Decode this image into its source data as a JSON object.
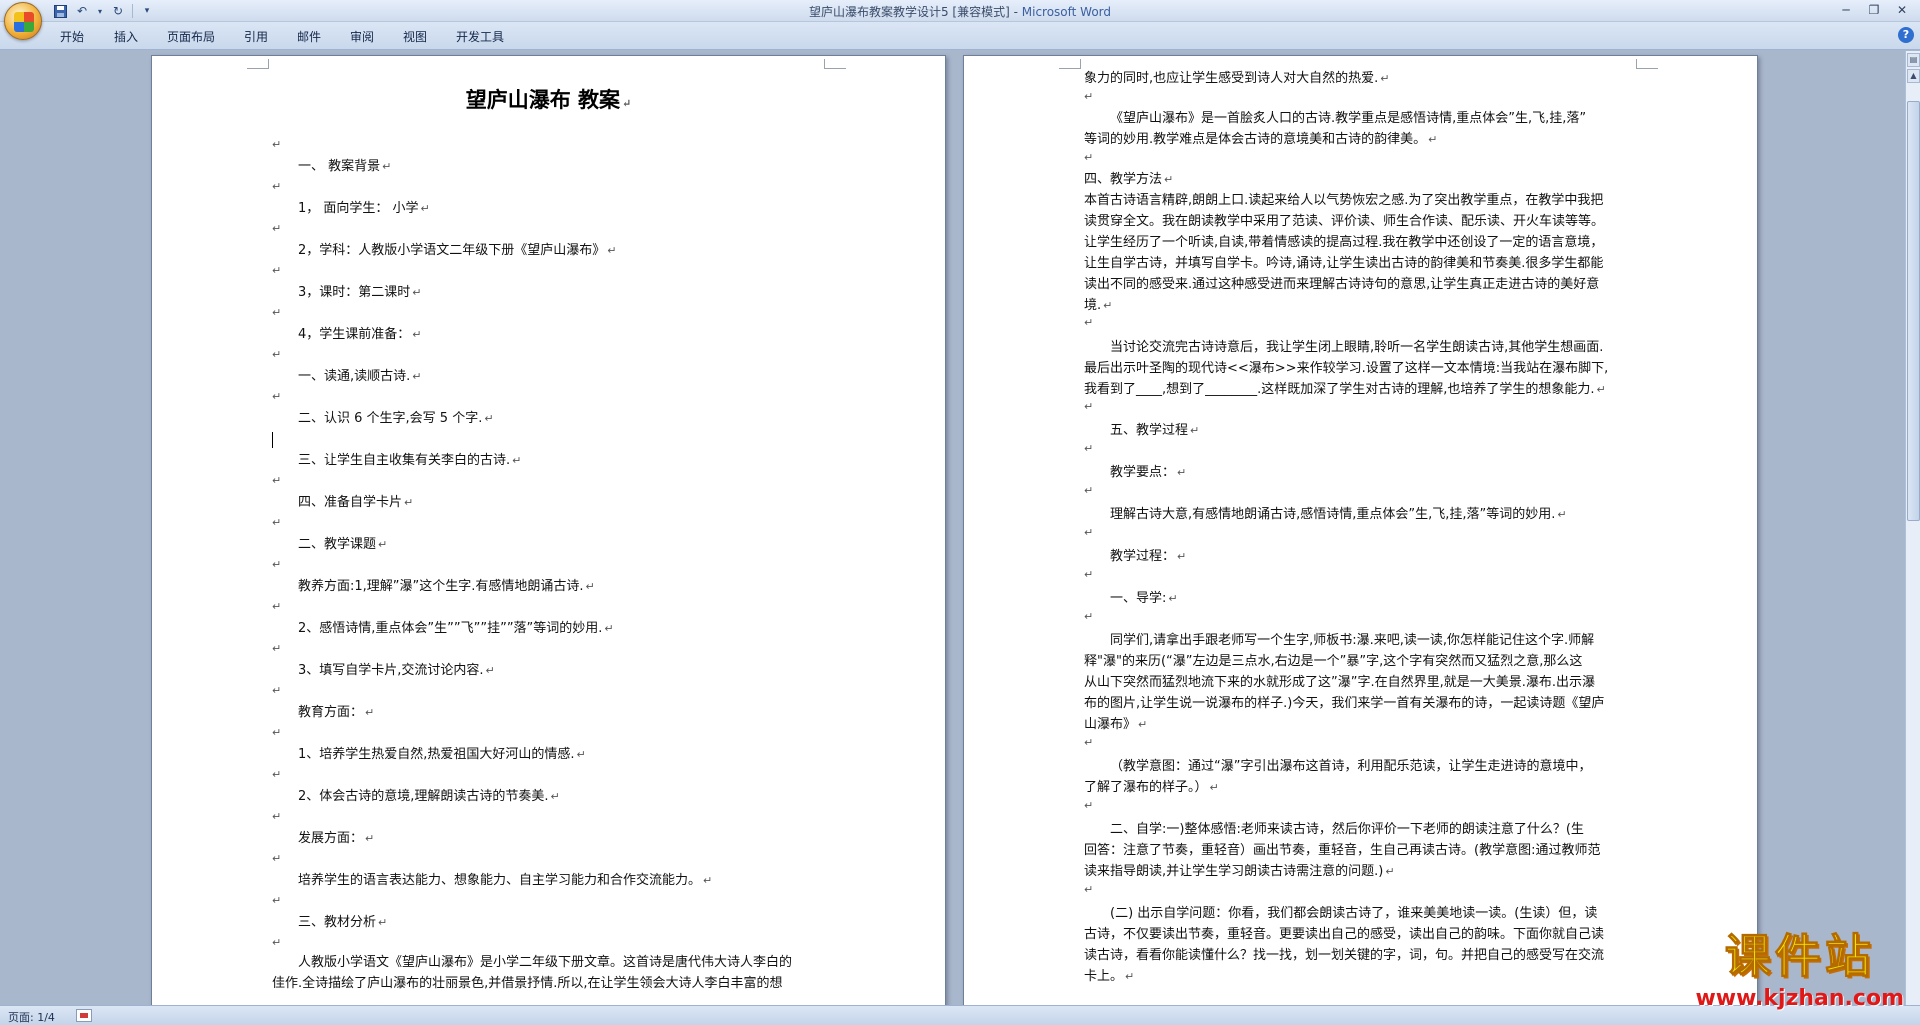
{
  "titlebar": {
    "doc_name": "望庐山瀑布教案教学设计5 [兼容模式]",
    "separator": " - ",
    "app_name": "Microsoft Word"
  },
  "quick_access": {
    "save": "save-icon",
    "undo": "undo-icon",
    "redo": "redo-icon",
    "customize": "dropdown-icon"
  },
  "ribbon": {
    "tabs": [
      "开始",
      "插入",
      "页面布局",
      "引用",
      "邮件",
      "审阅",
      "视图",
      "开发工具"
    ]
  },
  "left_page": {
    "title": "望庐山瀑布  教案",
    "lines": [
      "一、 教案背景",
      "1， 面向学生： 小学",
      "2，学科：人教版小学语文二年级下册《望庐山瀑布》",
      "3，课时：第二课时",
      "4，学生课前准备：",
      "一、读通,读顺古诗.",
      "二、认识 6 个生字,会写 5 个字.",
      "三、让学生自主收集有关李白的古诗.",
      "四、准备自学卡片",
      "二、教学课题",
      "教养方面:1,理解”瀑”这个生字.有感情地朗诵古诗.",
      "2、感悟诗情,重点体会”生””飞””挂””落”等词的妙用.",
      "3、填写自学卡片,交流讨论内容.",
      "教育方面：",
      "1、培养学生热爱自然,热爱祖国大好河山的情感.",
      "2、体会古诗的意境,理解朗读古诗的节奏美.",
      "发展方面：",
      "培养学生的语言表达能力、想象能力、自主学习能力和合作交流能力。",
      "三、教材分析",
      "人教版小学语文《望庐山瀑布》是小学二年级下册文章。这首诗是唐代伟大诗人李白的",
      "佳作.全诗描绘了庐山瀑布的壮丽景色,并借景抒情.所以,在让学生领会大诗人李白丰富的想"
    ]
  },
  "right_page": {
    "lines": [
      "象力的同时,也应让学生感受到诗人对大自然的热爱.",
      "《望庐山瀑布》是一首脍炙人口的古诗.教学重点是感悟诗情,重点体会”生,飞,挂,落”",
      "等词的妙用.教学难点是体会古诗的意境美和古诗的韵律美。",
      "四、教学方法",
      "本首古诗语言精辟,朗朗上口.读起来给人以气势恢宏之感.为了突出教学重点，在教学中我把",
      "读贯穿全文。我在朗读教学中采用了范读、评价读、师生合作读、配乐读、开火车读等等。",
      "让学生经历了一个听读,自读,带着情感读的提高过程.我在教学中还创设了一定的语言意境，",
      "让生自学古诗，并填写自学卡。吟诗,诵诗,让学生读出古诗的韵律美和节奏美.很多学生都能",
      "读出不同的感受来.通过这种感受进而来理解古诗诗句的意思,让学生真正走进古诗的美好意",
      "境.",
      "当讨论交流完古诗诗意后，我让学生闭上眼睛,聆听一名学生朗读古诗,其他学生想画面.",
      "最后出示叶圣陶的现代诗<<瀑布>>来作较学习.设置了这样一文本情境:当我站在瀑布脚下,",
      "我看到了____,想到了________.这样既加深了学生对古诗的理解,也培养了学生的想象能力.",
      "五、教学过程",
      "教学要点：",
      "理解古诗大意,有感情地朗诵古诗,感悟诗情,重点体会”生,飞,挂,落”等词的妙用.",
      "教学过程：",
      "一、导学:",
      "同学们,请拿出手跟老师写一个生字,师板书:瀑.来吧,读一读,你怎样能记住这个字.师解",
      "释\"瀑\"的来历(“瀑”左边是三点水,右边是一个”暴”字,这个字有突然而又猛烈之意,那么这",
      "从山下突然而猛烈地流下来的水就形成了这”瀑”字.在自然界里,就是一大美景.瀑布.出示瀑",
      "布的图片,让学生说一说瀑布的样子.)今天，我们来学一首有关瀑布的诗，一起读诗题《望庐",
      "山瀑布》",
      "（教学意图：通过“瀑”字引出瀑布这首诗，利用配乐范读，让学生走进诗的意境中，",
      "了解了瀑布的样子。）",
      "二、自学:一)整体感悟:老师来读古诗，然后你评价一下老师的朗读注意了什么？(生",
      "回答：注意了节奏，重轻音）画出节奏，重轻音，生自己再读古诗。(教学意图:通过教师范",
      "读来指导朗读,并让学生学习朗读古诗需注意的问题.)",
      "(二) 出示自学问题：你看，我们都会朗读古诗了，谁来美美地读一读。(生读）但，读",
      "古诗，不仅要读出节奏，重轻音。更要读出自己的感受，读出自己的韵味。下面你就自己读",
      "读古诗，看看你能读懂什么？找一找，划一划关键的字，词，句。并把自己的感受写在交流",
      "卡上。"
    ]
  },
  "statusbar": {
    "page_indicator": "页面: 1/4"
  },
  "watermark": {
    "main": "课件站",
    "url": "www.kjzhan.com"
  }
}
